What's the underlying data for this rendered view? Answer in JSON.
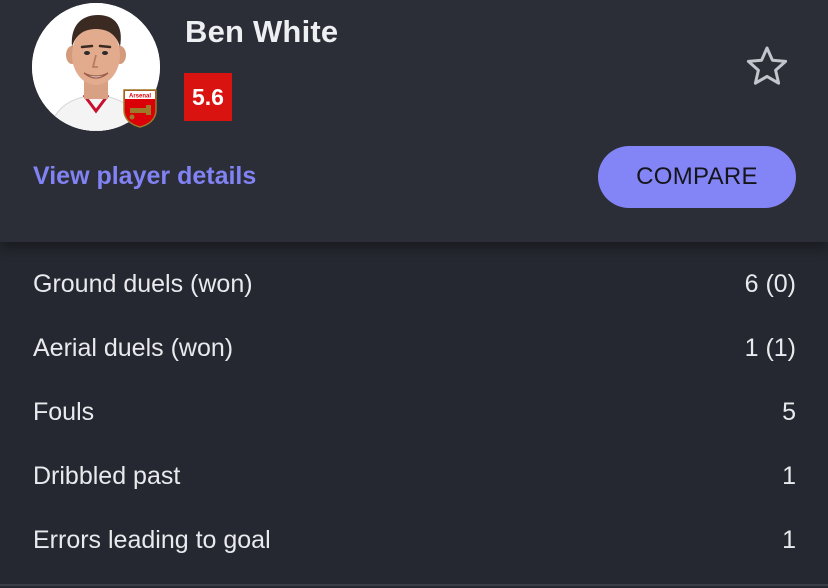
{
  "player": {
    "name": "Ben White",
    "rating": "5.6",
    "club_badge_text": "Arsenal",
    "avatar_icon": "player-photo",
    "favorite_icon": "star-outline-icon"
  },
  "actions": {
    "view_details_label": "View player details",
    "compare_label": "COMPARE"
  },
  "stats": [
    {
      "label": "Ground duels (won)",
      "value": "6 (0)"
    },
    {
      "label": "Aerial duels (won)",
      "value": "1 (1)"
    },
    {
      "label": "Fouls",
      "value": "5"
    },
    {
      "label": "Dribbled past",
      "value": "1"
    },
    {
      "label": "Errors leading to goal",
      "value": "1"
    }
  ],
  "colors": {
    "background": "#252830",
    "card": "#2b2e36",
    "accent": "#8384f6",
    "rating_red": "#d9130f",
    "text": "#e9eaee"
  }
}
